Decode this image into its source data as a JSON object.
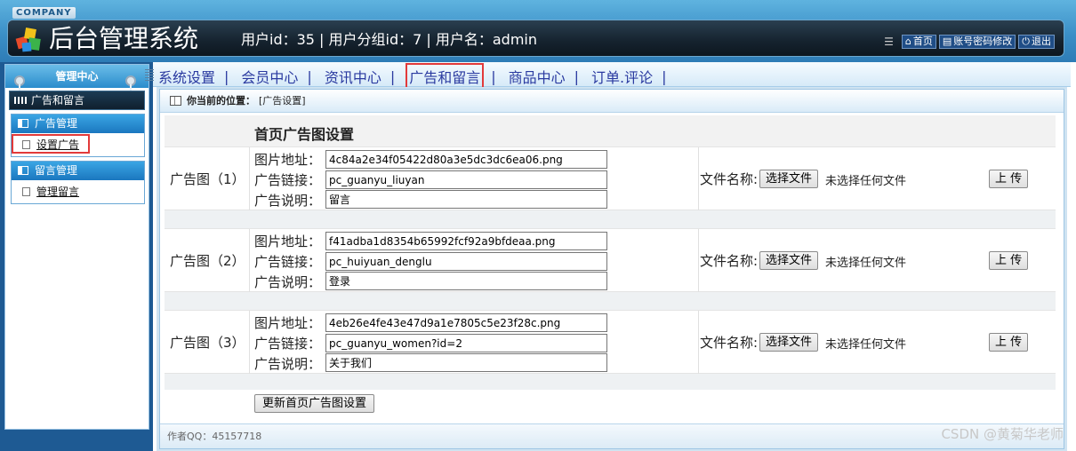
{
  "header": {
    "company": "COMPANY",
    "title": "后台管理系统",
    "userinfo": "用户id：35 | 用户分组id：7 | 用户名：admin",
    "links": [
      {
        "label": "首页",
        "icon": "home-icon"
      },
      {
        "label": "账号密码修改",
        "icon": "account-icon"
      },
      {
        "label": "退出",
        "icon": "power-icon"
      }
    ]
  },
  "left": {
    "tab_label": "管理中心",
    "section": "广告和留言",
    "groups": [
      {
        "title": "广告管理",
        "items": [
          "设置广告"
        ]
      },
      {
        "title": "留言管理",
        "items": [
          "管理留言"
        ]
      }
    ]
  },
  "topnav": {
    "items": [
      "系统设置",
      "会员中心",
      "资讯中心",
      "广告和留言",
      "商品中心",
      "订单.评论"
    ]
  },
  "location": {
    "prefix": "你当前的位置：",
    "path": "[广告设置]"
  },
  "form": {
    "title": "首页广告图设置",
    "field_labels": {
      "image": "图片地址：",
      "link": "广告链接：",
      "desc": "广告说明："
    },
    "file_label": "文件名称:",
    "choose_button": "选择文件",
    "no_file": "未选择任何文件",
    "upload_button": "上 传",
    "ads": [
      {
        "label": "广告图（1）",
        "image": "4c84a2e34f05422d80a3e5dc3dc6ea06.png",
        "link": "pc_guanyu_liuyan",
        "desc": "留言"
      },
      {
        "label": "广告图（2）",
        "image": "f41adba1d8354b65992fcf92a9bfdeaa.png",
        "link": "pc_huiyuan_denglu",
        "desc": "登录"
      },
      {
        "label": "广告图（3）",
        "image": "4eb26e4fe43e47d9a1e7805c5e23f28c.png",
        "link": "pc_guanyu_women?id=2",
        "desc": "关于我们"
      }
    ],
    "submit_button": "更新首页广告图设置"
  },
  "footer": "作者QQ：45157718",
  "watermark": "CSDN @黄菊华老师"
}
